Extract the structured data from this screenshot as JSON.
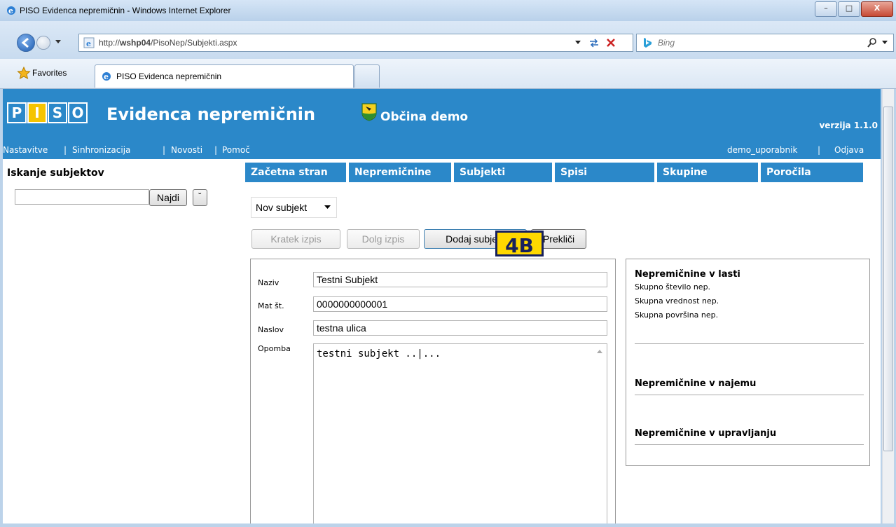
{
  "window": {
    "title": "PISO Evidenca nepremičnin - Windows Internet Explorer",
    "controls": {
      "minimize": "–",
      "maximize": "□",
      "close": "X"
    }
  },
  "browser": {
    "url_prefix": "http://",
    "url_host": "wshp04",
    "url_path": "/PisoNep/Subjekti.aspx",
    "search_engine": "Bing",
    "favorites_label": "Favorites",
    "tab_label": "PISO Evidenca nepremičnin"
  },
  "header": {
    "logo_letters": [
      "P",
      "I",
      "S",
      "O"
    ],
    "title": "Evidenca nepremičnin",
    "municipality": "Občina demo",
    "version": "verzija 1.1.0",
    "links": [
      "Nastavitve",
      "Sinhronizacija",
      "Novosti",
      "Pomoč"
    ],
    "separator": "|",
    "user": "demo_uporabnik",
    "logout": "Odjava"
  },
  "sidebar": {
    "title": "Iskanje subjektov",
    "search_value": "",
    "search_button": "Najdi",
    "expand_button": "˘"
  },
  "menu": [
    "Začetna stran",
    "Nepremičnine",
    "Subjekti",
    "Spisi",
    "Skupine",
    "Poročila"
  ],
  "toolbar": {
    "select_value": "Nov subjekt",
    "short_print": "Kratek izpis",
    "long_print": "Dolg izpis",
    "add_subject": "Dodaj subjekt",
    "cancel": "Prekliči"
  },
  "form": {
    "naziv_label": "Naziv",
    "naziv_value": "Testni Subjekt",
    "mat_label": "Mat št.",
    "mat_value": "0000000000001",
    "naslov_label": "Naslov",
    "naslov_value": "testna ulica",
    "opomba_label": "Opomba",
    "opomba_value": "testni subjekt ..|..."
  },
  "right_panel": {
    "owned_title": "Nepremičnine v lasti",
    "owned_lines": [
      "Skupno število nep.",
      "Skupna vrednost nep.",
      "Skupna površina nep."
    ],
    "rented_title": "Nepremičnine v najemu",
    "managed_title": "Nepremičnine v upravljanju"
  },
  "annotation": "4B",
  "colors": {
    "header_blue": "#2b88c9",
    "logo_yellow": "#f5c400",
    "badge_yellow": "#ffd800",
    "badge_navy": "#17205c"
  }
}
